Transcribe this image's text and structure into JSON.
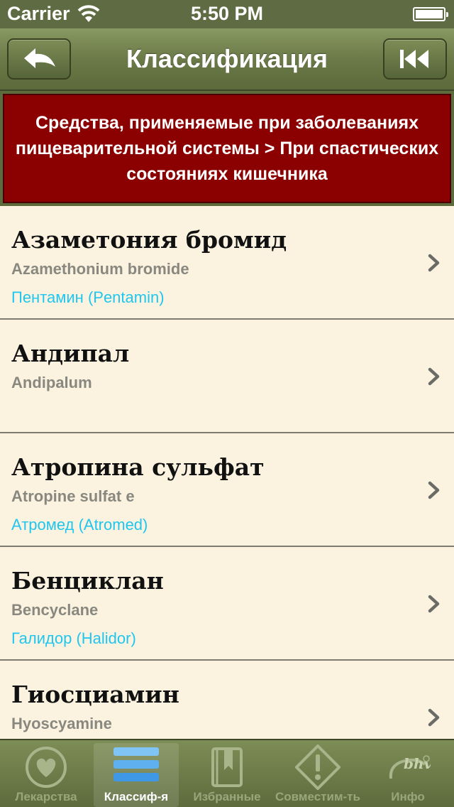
{
  "status_bar": {
    "carrier": "Carrier",
    "time": "5:50 PM"
  },
  "nav": {
    "title": "Классификация",
    "back_icon": "back-arrow-icon",
    "first_icon": "skip-to-start-icon"
  },
  "header": {
    "text": "Средства, применяемые при заболеваниях пищеварительной системы > При спастических состояниях кишечника"
  },
  "items": [
    {
      "name": "Азаметония бромид",
      "latin": "Azamethonium bromide",
      "trade": "Пентамин (Pentamin)"
    },
    {
      "name": "Андипал",
      "latin": "Andipalum",
      "trade": ""
    },
    {
      "name": "Атропина сульфат",
      "latin": "Atropine sulfat e",
      "trade": "Атромед (Atromed)"
    },
    {
      "name": "Бенциклан",
      "latin": "Bencyclane",
      "trade": "Галидор (Halidor)"
    },
    {
      "name": "Гиосциамин",
      "latin": "Hyoscyamine",
      "trade": ""
    }
  ],
  "tabs": [
    {
      "label": "Лекарства",
      "icon": "heart-icon",
      "active": false
    },
    {
      "label": "Классиф-я",
      "icon": "list-icon",
      "active": true
    },
    {
      "label": "Избранные",
      "icon": "bookmark-book-icon",
      "active": false
    },
    {
      "label": "Совместим-ть",
      "icon": "warning-icon",
      "active": false
    },
    {
      "label": "Инфо",
      "icon": "bhv-logo-icon",
      "active": false
    }
  ],
  "colors": {
    "nav_green": "#6b7a48",
    "header_red": "#8b0000",
    "list_bg": "#fbf3df",
    "trade_link": "#1fc6ef"
  }
}
